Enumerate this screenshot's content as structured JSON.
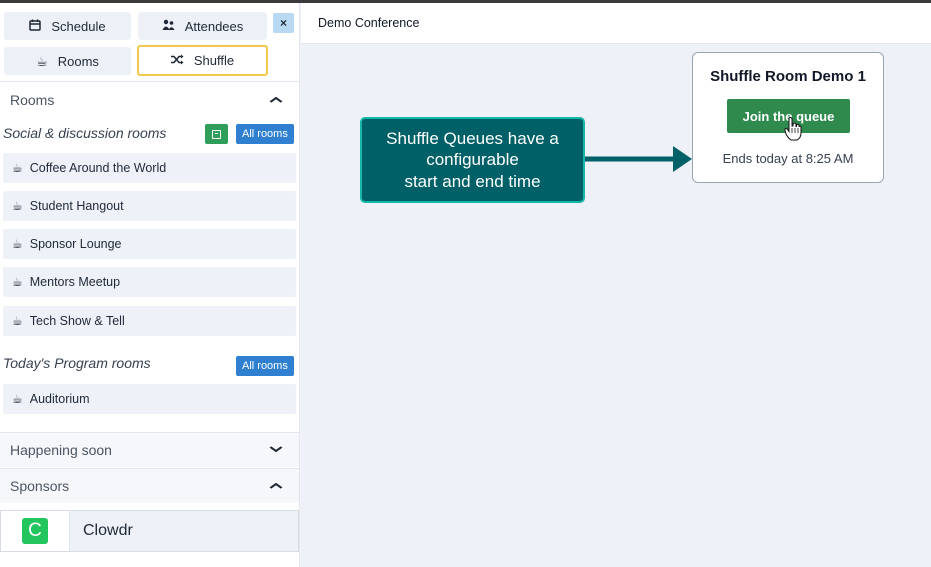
{
  "sidebar": {
    "nav": {
      "schedule": "Schedule",
      "attendees": "Attendees",
      "rooms": "Rooms",
      "shuffle": "Shuffle",
      "close": "×"
    },
    "rooms_header": "Rooms",
    "social_group": {
      "label": "Social & discussion rooms",
      "all_rooms": "All rooms",
      "items": [
        "Coffee Around the World",
        "Student Hangout",
        "Sponsor Lounge",
        "Mentors Meetup",
        "Tech Show & Tell"
      ]
    },
    "program_group": {
      "label": "Today's Program rooms",
      "all_rooms": "All rooms",
      "items": [
        "Auditorium"
      ]
    },
    "happening_soon": "Happening soon",
    "sponsors_header": "Sponsors",
    "sponsor": {
      "logo_letter": "C",
      "name": "Clowdr"
    }
  },
  "main": {
    "conference_title": "Demo Conference",
    "callout": {
      "line1": "Shuffle Queues have a",
      "line2": "configurable",
      "line3": "start and end time"
    },
    "shuffle_card": {
      "title": "Shuffle Room Demo 1",
      "join_label": "Join the queue",
      "ends_text": "Ends today at 8:25 AM"
    }
  },
  "colors": {
    "accent_blue": "#2f80d0",
    "join_green": "#2f8a4e",
    "callout_teal": "#006068",
    "active_border": "#f2c94c",
    "sponsor_logo": "#22c55e"
  },
  "icons": {
    "schedule": "calendar-icon",
    "attendees": "people-icon",
    "rooms": "coffee-cup-icon",
    "shuffle": "shuffle-icon",
    "close": "close-icon",
    "chevron_up": "chevron-up-icon",
    "chevron_down": "chevron-down-icon",
    "add": "add-room-icon",
    "room": "coffee-cup-icon",
    "cursor": "hand-cursor-icon"
  }
}
